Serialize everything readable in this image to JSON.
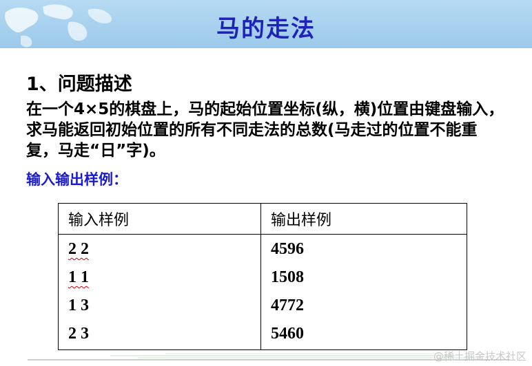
{
  "slide": {
    "title": "马的走法",
    "heading": "1、问题描述",
    "description": "在一个4×5的棋盘上，马的起始位置坐标(纵，横)位置由键盘输入，求马能返回初始位置的所有不同走法的总数(马走过的位置不能重复，马走“日”字)。",
    "sample_label": "输入输出样例：",
    "table": {
      "headers": [
        "输入样例",
        "输出样例"
      ],
      "rows": [
        {
          "input": "2 2",
          "output": "4596"
        },
        {
          "input": "1 1",
          "output": "1508"
        },
        {
          "input": "1 3",
          "output": "4772"
        },
        {
          "input": "2 3",
          "output": "5460"
        }
      ]
    }
  },
  "watermark": "@稀土掘金技术社区",
  "colors": {
    "title": "#1f22b8",
    "sample_label": "#1a1ad0",
    "header_bg": "#a7d1ee",
    "spellcheck_underline": "#d40000"
  }
}
